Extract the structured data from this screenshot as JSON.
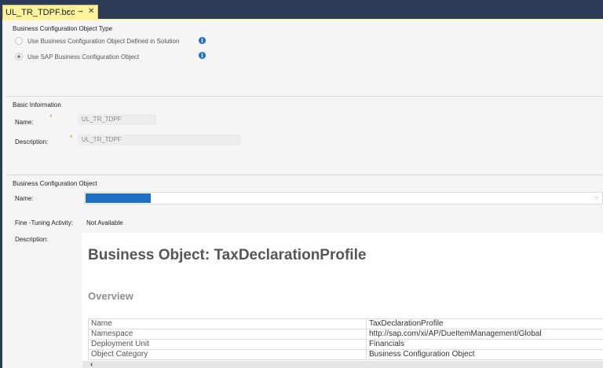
{
  "tab": {
    "title": "UL_TR_TDPF.bcc",
    "pin_icon": "pin-icon",
    "close_icon": "close-icon"
  },
  "bco_type": {
    "title": "Business Configuration Object Type",
    "options": [
      {
        "label": "Use Business Configuration Object Defined in Solution",
        "selected": false
      },
      {
        "label": "Use SAP Business Configuration Object",
        "selected": true
      }
    ]
  },
  "basic_info": {
    "title": "Basic Information",
    "name_label": "Name:",
    "name_value": "UL_TR_TDPF",
    "description_label": "Description:",
    "description_value": "UL_TR_TDPF"
  },
  "bco": {
    "title": "Business Configuration Object",
    "name_label": "Name:",
    "name_value": "",
    "fine_tuning_label": "Fine -Tuning Activity:",
    "fine_tuning_value": "Not Available",
    "description_label": "Description:"
  },
  "doc": {
    "heading": "Business Object: TaxDeclarationProfile",
    "overview_heading": "Overview",
    "rows": [
      {
        "key": "Name",
        "value": "TaxDeclarationProfile"
      },
      {
        "key": "Namespace",
        "value": "http://sap.com/xi/AP/DueItemManagement/Global"
      },
      {
        "key": "Deployment Unit",
        "value": "Financials"
      },
      {
        "key": "Object Category",
        "value": "Business Configuration Object"
      }
    ]
  },
  "colors": {
    "chrome": "#2d3c56",
    "active_tab": "#fff29d",
    "selection": "#1f6fc5",
    "info": "#1b6ec2",
    "required": "#e0881c"
  }
}
